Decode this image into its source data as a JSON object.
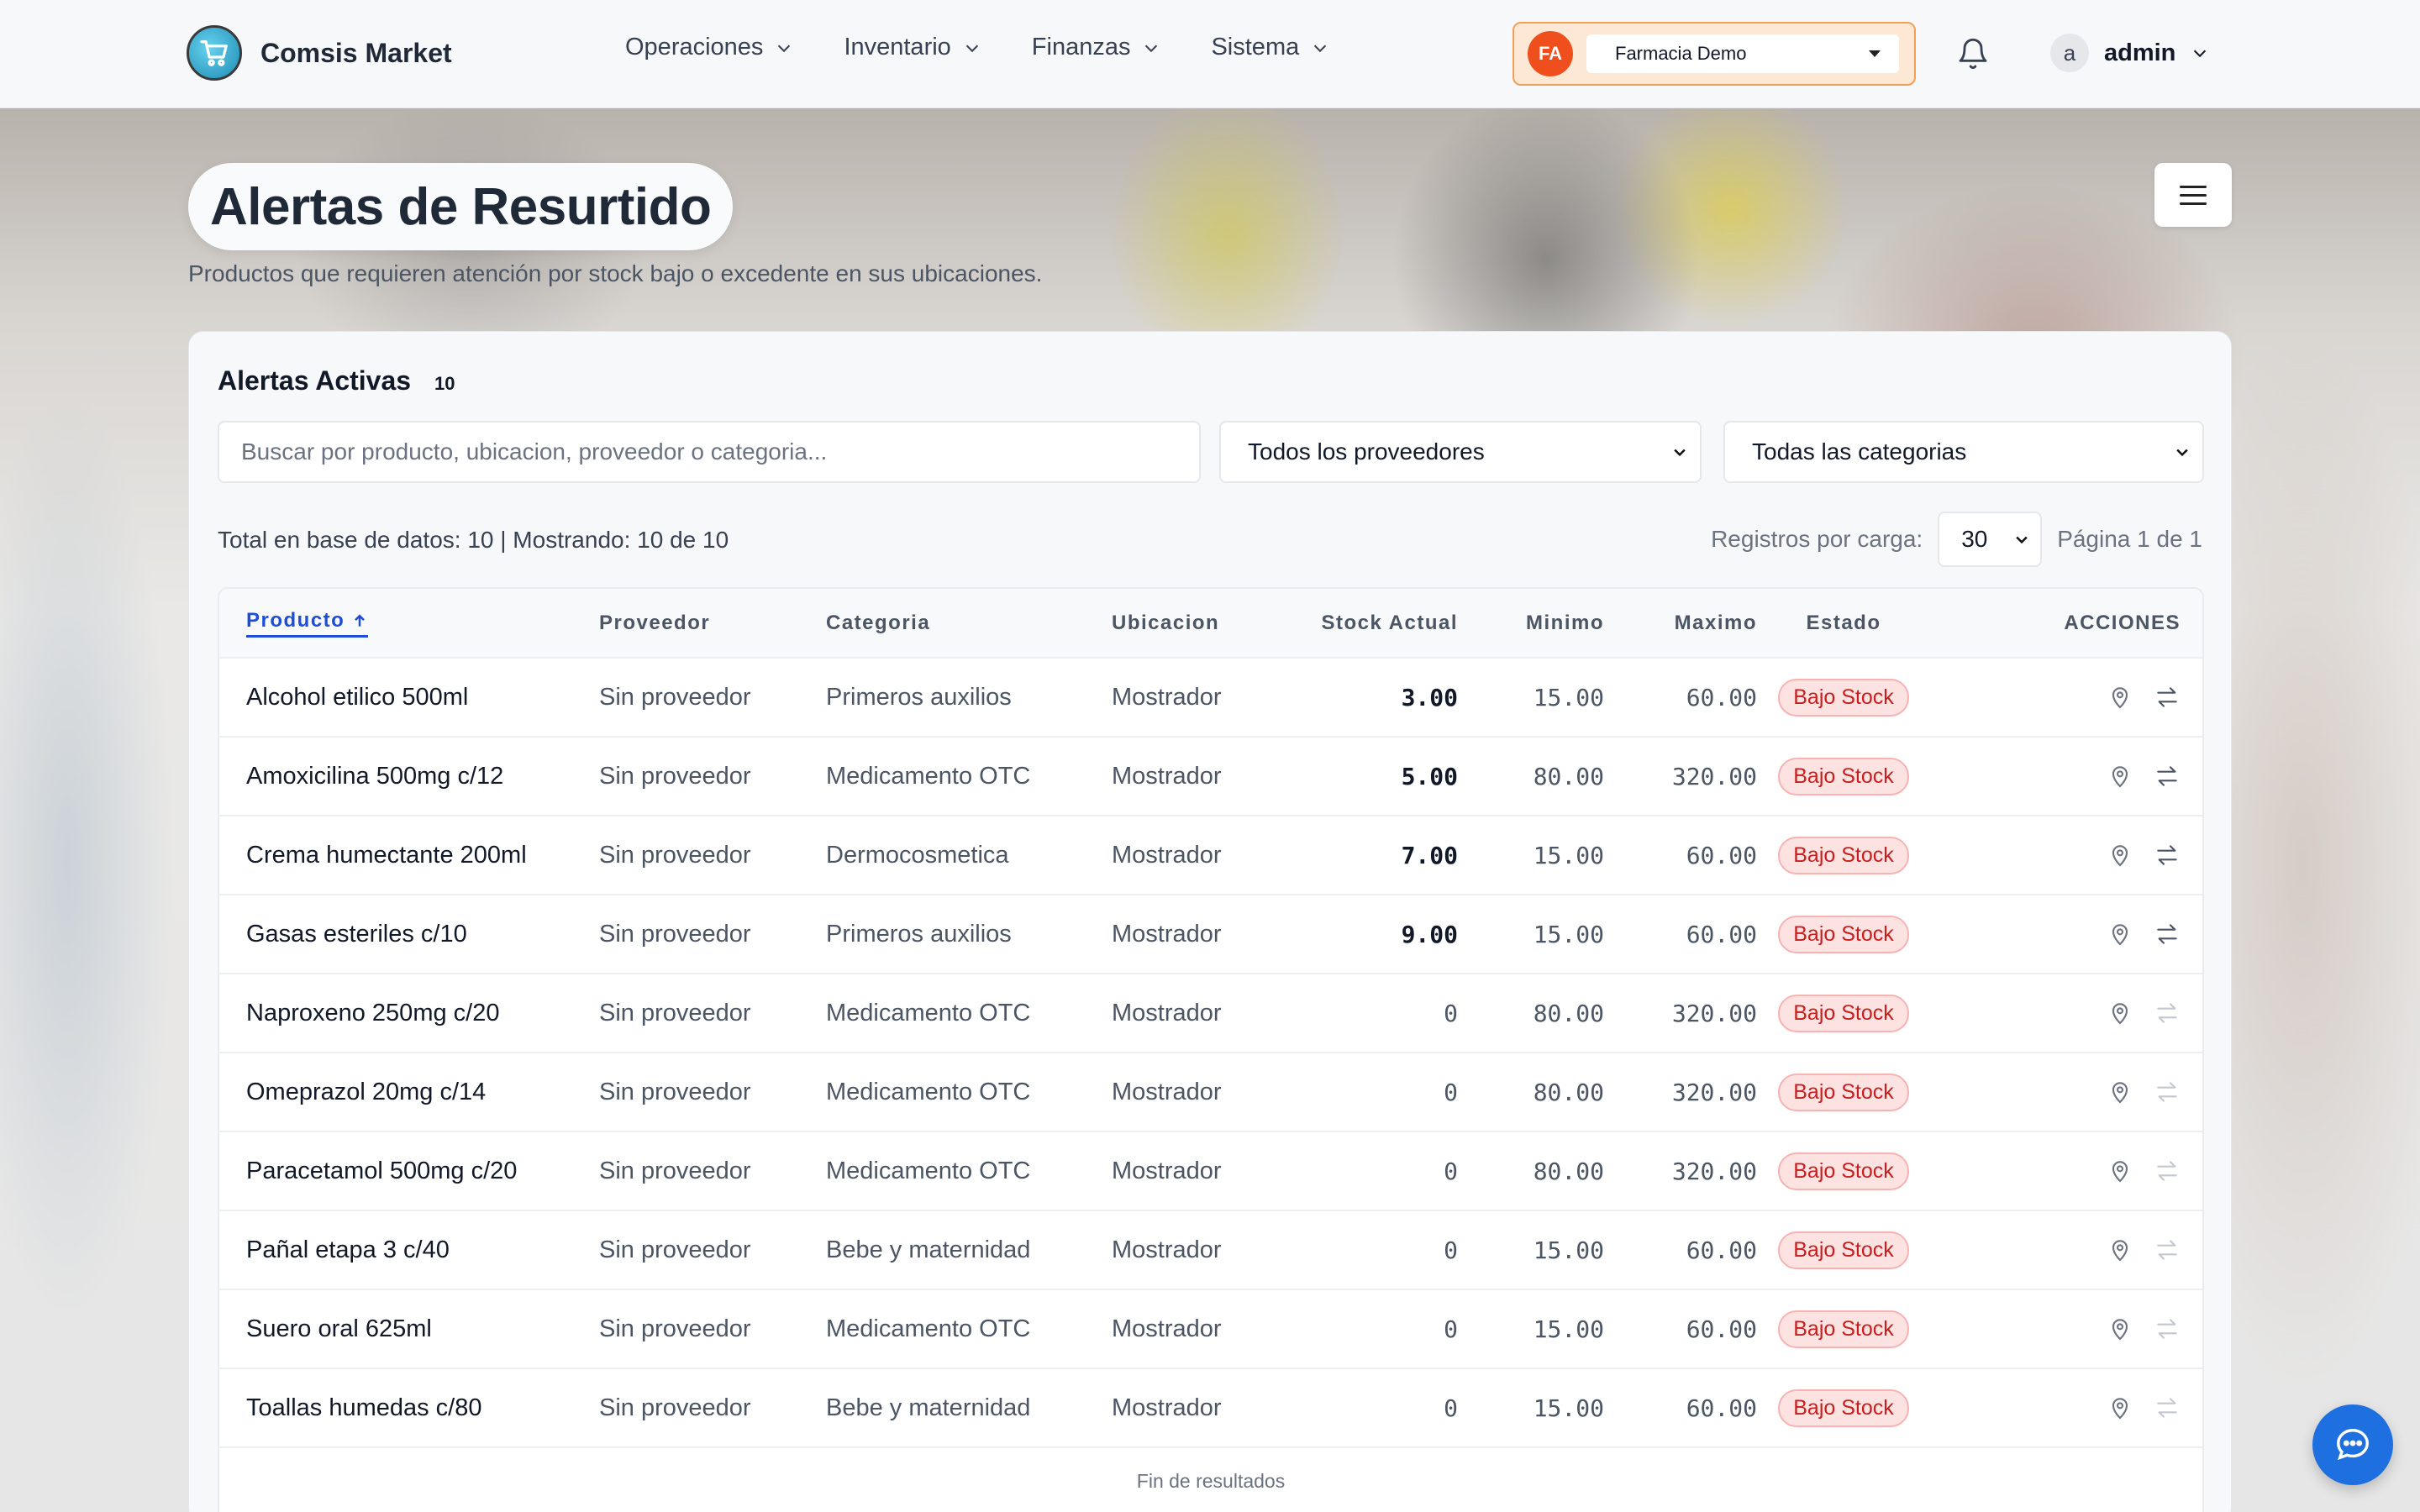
{
  "app": {
    "name": "Comsis Market",
    "logo_icon": "cart-icon"
  },
  "nav": [
    {
      "label": "Operaciones"
    },
    {
      "label": "Inventario"
    },
    {
      "label": "Finanzas"
    },
    {
      "label": "Sistema"
    }
  ],
  "branch": {
    "initials": "FA",
    "name": "Farmacia Demo",
    "accent": "#ee4f1c"
  },
  "user": {
    "initial": "a",
    "name": "admin"
  },
  "page": {
    "title": "Alertas de Resurtido",
    "subtitle": "Productos que requieren atención por stock bajo o excedente en sus ubicaciones."
  },
  "alerts": {
    "title": "Alertas Activas",
    "count": "10",
    "search_placeholder": "Buscar por producto, ubicacion, proveedor o categoria...",
    "supplier_filter": "Todos los proveedores",
    "category_filter": "Todas las categorias",
    "totals_text": "Total en base de datos: 10 | Mostrando: 10 de 10",
    "per_page_label": "Registros por carga:",
    "per_page_value": "30",
    "page_text": "Página 1 de 1",
    "end_text": "Fin de resultados"
  },
  "table": {
    "columns": [
      "Producto",
      "Proveedor",
      "Categoria",
      "Ubicacion",
      "Stock Actual",
      "Minimo",
      "Maximo",
      "Estado",
      "ACCIONES"
    ],
    "sort_column": "Producto",
    "rows": [
      {
        "producto": "Alcohol etilico 500ml",
        "proveedor": "Sin proveedor",
        "categoria": "Primeros auxilios",
        "ubicacion": "Mostrador",
        "stock": "3.00",
        "minimo": "15.00",
        "maximo": "60.00",
        "estado": "Bajo Stock",
        "transfer_enabled": true
      },
      {
        "producto": "Amoxicilina 500mg c/12",
        "proveedor": "Sin proveedor",
        "categoria": "Medicamento OTC",
        "ubicacion": "Mostrador",
        "stock": "5.00",
        "minimo": "80.00",
        "maximo": "320.00",
        "estado": "Bajo Stock",
        "transfer_enabled": true
      },
      {
        "producto": "Crema humectante 200ml",
        "proveedor": "Sin proveedor",
        "categoria": "Dermocosmetica",
        "ubicacion": "Mostrador",
        "stock": "7.00",
        "minimo": "15.00",
        "maximo": "60.00",
        "estado": "Bajo Stock",
        "transfer_enabled": true
      },
      {
        "producto": "Gasas esteriles c/10",
        "proveedor": "Sin proveedor",
        "categoria": "Primeros auxilios",
        "ubicacion": "Mostrador",
        "stock": "9.00",
        "minimo": "15.00",
        "maximo": "60.00",
        "estado": "Bajo Stock",
        "transfer_enabled": true
      },
      {
        "producto": "Naproxeno 250mg c/20",
        "proveedor": "Sin proveedor",
        "categoria": "Medicamento OTC",
        "ubicacion": "Mostrador",
        "stock": "0",
        "minimo": "80.00",
        "maximo": "320.00",
        "estado": "Bajo Stock",
        "transfer_enabled": false
      },
      {
        "producto": "Omeprazol 20mg c/14",
        "proveedor": "Sin proveedor",
        "categoria": "Medicamento OTC",
        "ubicacion": "Mostrador",
        "stock": "0",
        "minimo": "80.00",
        "maximo": "320.00",
        "estado": "Bajo Stock",
        "transfer_enabled": false
      },
      {
        "producto": "Paracetamol 500mg c/20",
        "proveedor": "Sin proveedor",
        "categoria": "Medicamento OTC",
        "ubicacion": "Mostrador",
        "stock": "0",
        "minimo": "80.00",
        "maximo": "320.00",
        "estado": "Bajo Stock",
        "transfer_enabled": false
      },
      {
        "producto": "Pañal etapa 3 c/40",
        "proveedor": "Sin proveedor",
        "categoria": "Bebe y maternidad",
        "ubicacion": "Mostrador",
        "stock": "0",
        "minimo": "15.00",
        "maximo": "60.00",
        "estado": "Bajo Stock",
        "transfer_enabled": false
      },
      {
        "producto": "Suero oral 625ml",
        "proveedor": "Sin proveedor",
        "categoria": "Medicamento OTC",
        "ubicacion": "Mostrador",
        "stock": "0",
        "minimo": "15.00",
        "maximo": "60.00",
        "estado": "Bajo Stock",
        "transfer_enabled": false
      },
      {
        "producto": "Toallas humedas c/80",
        "proveedor": "Sin proveedor",
        "categoria": "Bebe y maternidad",
        "ubicacion": "Mostrador",
        "stock": "0",
        "minimo": "15.00",
        "maximo": "60.00",
        "estado": "Bajo Stock",
        "transfer_enabled": false
      }
    ]
  },
  "colors": {
    "badge_text": "#c81e1e",
    "badge_bg": "#fde2e2",
    "link": "#1d4ed8",
    "chat": "#1e70e0"
  }
}
